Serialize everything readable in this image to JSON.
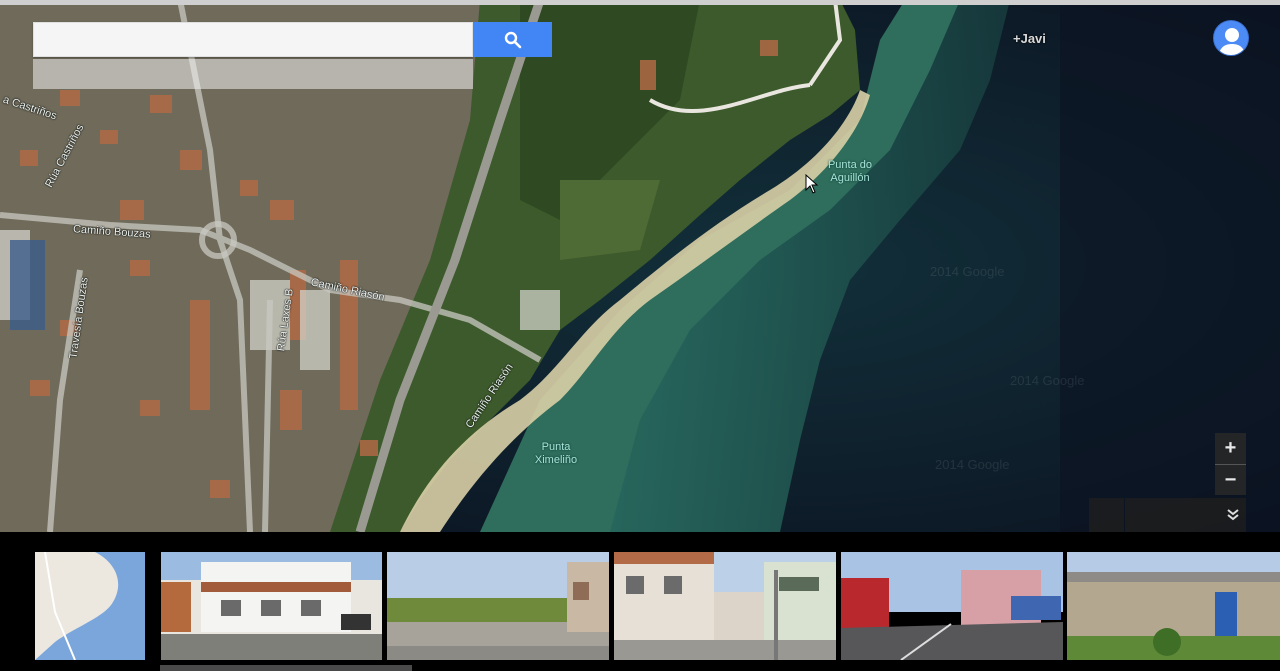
{
  "search": {
    "value": "",
    "placeholder": ""
  },
  "header": {
    "user_link": "+Javi"
  },
  "map": {
    "street_labels": {
      "rua_castrinos_a": "a Castriños",
      "rua_castrinos_b": "Rúa Castriños",
      "camino_bouzas": "Camiño Bouzas",
      "travesia_bouzas": "Travesía Bouzas",
      "rua_laxes": "Rúa Laxes B",
      "camino_riason_a": "Camiño Riasón",
      "camino_riason_b": "Camiño Riasón"
    },
    "places": {
      "punta_aguillon_line1": "Punta do",
      "punta_aguillon_line2": "Aguillón",
      "punta_ximelino_line1": "Punta",
      "punta_ximelino_line2": "Ximeliño"
    },
    "watermarks": [
      "2014 Google",
      "2014 Google",
      "2014 Google"
    ],
    "zoom": {
      "in_label": "+",
      "out_label": "−"
    }
  },
  "colors": {
    "search_button": "#4285f4",
    "avatar": "#4c8bf5",
    "sea_dark": "#0e1a24",
    "sea_teal": "#1f5a50"
  },
  "filmstrip": {
    "thumbnails": [
      "map-thumbnail",
      "white-house",
      "field-with-wall",
      "townhouses",
      "street-red-building",
      "stone-shed"
    ]
  }
}
